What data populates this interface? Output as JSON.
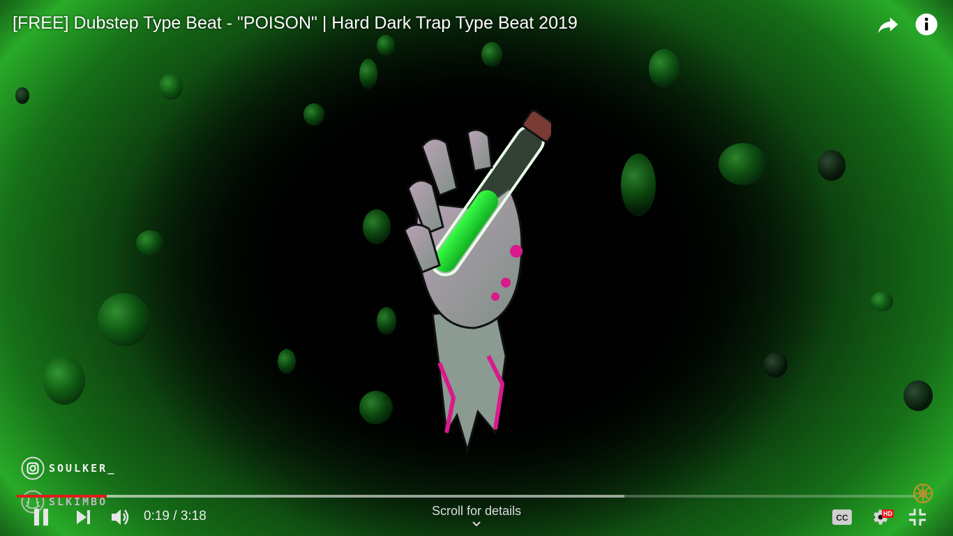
{
  "video": {
    "title": "[FREE] Dubstep Type Beat - \"POISON\" | Hard Dark Trap Type Beat 2019"
  },
  "top_bar": {
    "share_icon": "share-arrow-icon",
    "info_icon": "info-icon"
  },
  "overlay": {
    "instagram": {
      "icon": "instagram-icon",
      "handle": "SOULKER_"
    },
    "snapchat": {
      "icon": "snapchat-icon",
      "handle": "SLKIMBO"
    }
  },
  "player": {
    "progress": {
      "played_fraction": 0.1,
      "buffered_fraction": 0.675,
      "color": "#e21b1b"
    },
    "current_time": "0:19",
    "duration": "3:18",
    "time_display": "0:19 / 3:18",
    "scroll_hint": "Scroll for details",
    "quality_badge": "HD",
    "controls": {
      "play_pause": "pause-icon",
      "next": "next-icon",
      "volume": "volume-icon",
      "captions": "cc-icon",
      "settings": "gear-icon",
      "fullscreen_exit": "exit-fullscreen-icon"
    }
  },
  "colors": {
    "accent_green": "#2fbf2f",
    "progress_red": "#e21b1b"
  }
}
